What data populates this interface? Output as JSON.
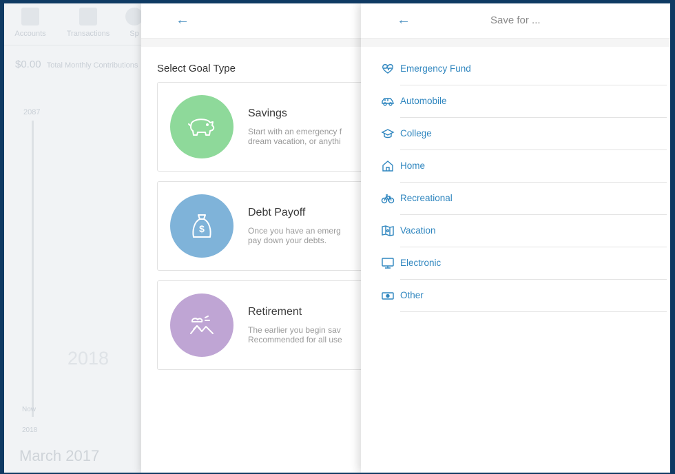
{
  "background_app": {
    "nav": [
      "Accounts",
      "Transactions",
      "Sp"
    ],
    "contribution_amount": "$0.00",
    "contribution_label": "Total Monthly Contributions",
    "year_top": "2087",
    "year_mid": "2018",
    "now_label": "Now",
    "year_bottom": "2018",
    "current_month": "March 2017"
  },
  "goal_panel": {
    "back_icon": "back-arrow-icon",
    "title": "Select Goal Type",
    "goals": [
      {
        "name": "Savings",
        "description": "Start with an emergency f\ndream vacation, or anythi",
        "icon": "piggy-bank-icon",
        "color": "#8ed99a"
      },
      {
        "name": "Debt Payoff",
        "description": "Once you have an emerg\npay down your debts.",
        "icon": "money-bag-icon",
        "color": "#7fb3d9"
      },
      {
        "name": "Retirement",
        "description": "The earlier you begin sav\nRecommended for all use",
        "icon": "sunset-mountains-icon",
        "color": "#bfa5d4"
      }
    ]
  },
  "save_panel": {
    "back_icon": "back-arrow-icon",
    "title": "Save for ...",
    "items": [
      {
        "label": "Emergency Fund",
        "icon": "heartbeat-icon"
      },
      {
        "label": "Automobile",
        "icon": "car-icon"
      },
      {
        "label": "College",
        "icon": "graduation-cap-icon"
      },
      {
        "label": "Home",
        "icon": "house-icon"
      },
      {
        "label": "Recreational",
        "icon": "bicycle-icon"
      },
      {
        "label": "Vacation",
        "icon": "map-icon"
      },
      {
        "label": "Electronic",
        "icon": "monitor-icon"
      },
      {
        "label": "Other",
        "icon": "cash-icon"
      }
    ]
  },
  "colors": {
    "accent": "#2f86bf",
    "frame": "#0f3a63"
  }
}
